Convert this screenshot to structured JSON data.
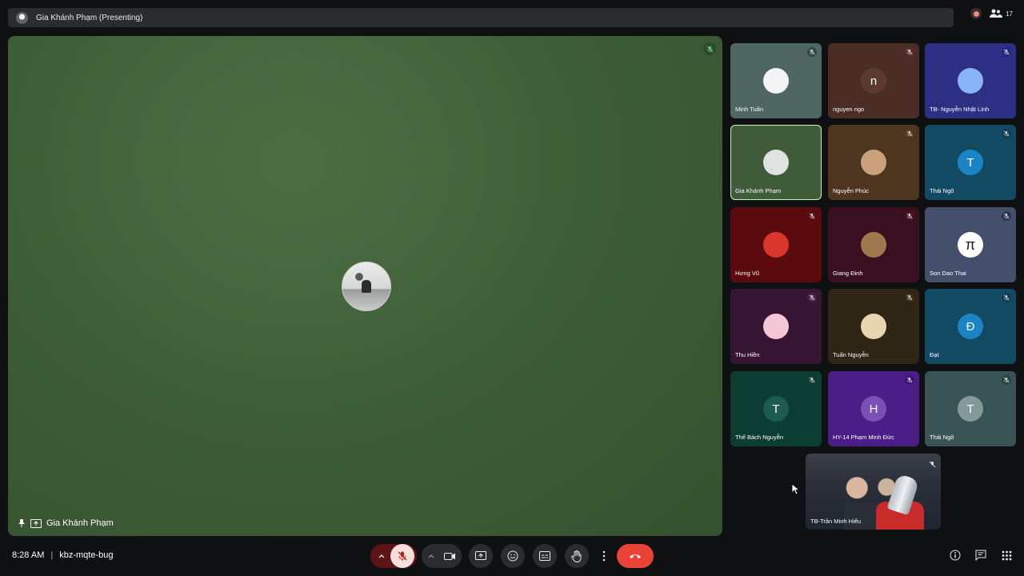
{
  "topbar": {
    "title": "Gia Khánh Phạm (Presenting)",
    "participant_count": "17"
  },
  "stage": {
    "presenter_name": "Gia Khánh Phạm"
  },
  "tiles": [
    {
      "name": "Minh Tuấn",
      "initial": "",
      "bg": "#4f6663",
      "avatar_bg": "#f4f4f4",
      "mic_color": "#2e4a47"
    },
    {
      "name": "nguyen ngo",
      "initial": "n",
      "bg": "#4a2d24",
      "avatar_bg": "#5d3a30",
      "mic_color": "#5b2b2b"
    },
    {
      "name": "TB- Nguyễn Nhật Linh",
      "initial": "",
      "bg": "#2c2f84",
      "avatar_bg": "#8ab4f8",
      "mic_color": "#24277a"
    },
    {
      "name": "Gia Khánh Phạm",
      "initial": "",
      "bg": "#3f5b39",
      "avatar_bg": "#dfe3df",
      "mic_color": "",
      "active": true
    },
    {
      "name": "Nguyễn Phúc",
      "initial": "",
      "bg": "#4e3520",
      "avatar_bg": "#c9a27a",
      "mic_color": "#5a3a1f"
    },
    {
      "name": "Thái Ngô",
      "initial": "T",
      "bg": "#124a63",
      "avatar_bg": "#1a84c4",
      "mic_color": "#0f3d53"
    },
    {
      "name": "Hưng Vũ",
      "initial": "",
      "bg": "#5b0a0d",
      "avatar_bg": "#d9372b",
      "mic_color": "#5b0a0d"
    },
    {
      "name": "Giang Đinh",
      "initial": "",
      "bg": "#3a1020",
      "avatar_bg": "#a0784f",
      "mic_color": "#4a1020"
    },
    {
      "name": "Son Dao Thai",
      "initial": "π",
      "bg": "#44506b",
      "avatar_bg": "#ffffff",
      "mic_color": "#2a3250"
    },
    {
      "name": "Thu Hiền",
      "initial": "",
      "bg": "#361632",
      "avatar_bg": "#f5c6d6",
      "mic_color": "#4a1e45"
    },
    {
      "name": "Tuấn Nguyễn",
      "initial": "",
      "bg": "#2e2514",
      "avatar_bg": "#e8d6b3",
      "mic_color": "#3a2e16"
    },
    {
      "name": "Đạt",
      "initial": "Đ",
      "bg": "#124a63",
      "avatar_bg": "#1a84c4",
      "mic_color": "#0f3d53"
    },
    {
      "name": "Thế Bách Nguyễn",
      "initial": "T",
      "bg": "#0c3d33",
      "avatar_bg": "#1b5c4d",
      "mic_color": "#0c3d33"
    },
    {
      "name": "HY-14 Phạm Minh Đức",
      "initial": "H",
      "bg": "#4a1e86",
      "avatar_bg": "#7a4fb8",
      "mic_color": "#3a1570"
    },
    {
      "name": "Thái Ngô",
      "initial": "T",
      "bg": "#3a5455",
      "avatar_bg": "#84999a",
      "mic_color": "#2c4142"
    }
  ],
  "selfview": {
    "name": "TB-Trần Minh Hiếu"
  },
  "bottom": {
    "time": "8:28 AM",
    "meeting_code": "kbz-mqte-bug"
  },
  "colors": {
    "end_call": "#ea4335",
    "mic_muted_bg": "#f9dedc",
    "mic_muted_icon": "#b3261e"
  }
}
